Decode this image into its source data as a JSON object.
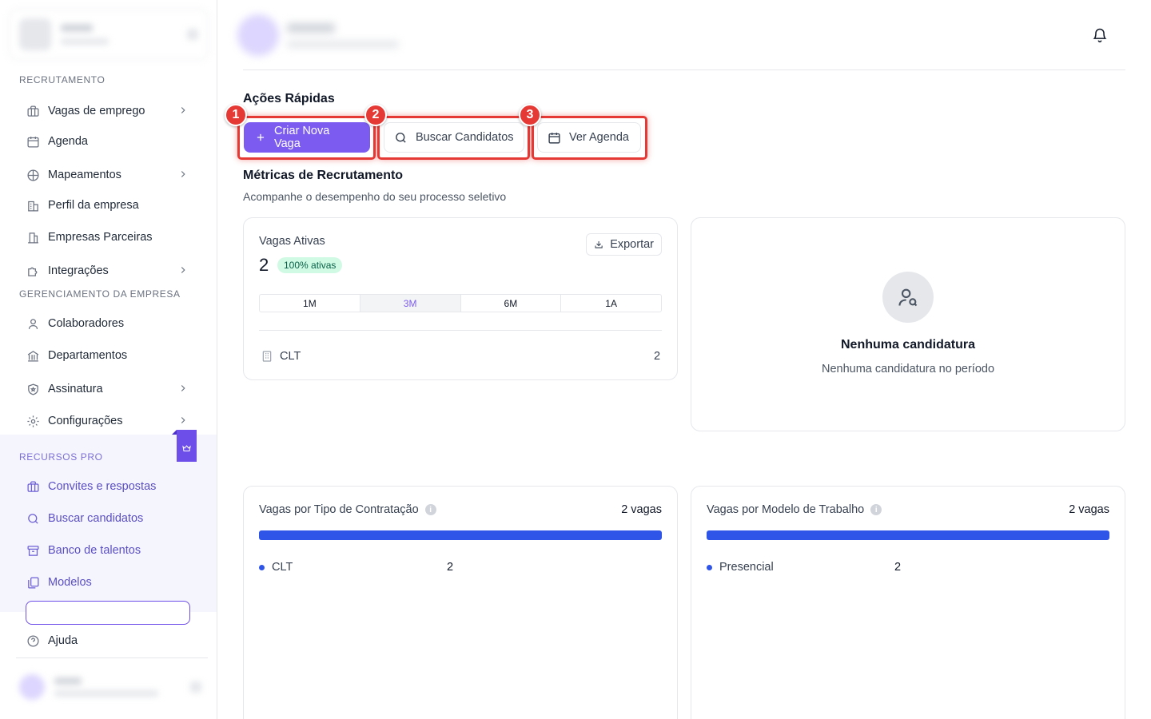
{
  "sidebar": {
    "sections": {
      "recruitment": "RECRUTAMENTO",
      "company": "GERENCIAMENTO DA EMPRESA",
      "pro": "RECURSOS PRO"
    },
    "items": {
      "vagas": "Vagas de emprego",
      "agenda": "Agenda",
      "mapeamentos": "Mapeamentos",
      "perfil": "Perfil da empresa",
      "parceiras": "Empresas Parceiras",
      "integracoes": "Integrações",
      "colaboradores": "Colaboradores",
      "departamentos": "Departamentos",
      "assinatura": "Assinatura",
      "configuracoes": "Configurações",
      "convites": "Convites e respostas",
      "buscar": "Buscar candidatos",
      "banco": "Banco de talentos",
      "modelos": "Modelos",
      "ajuda": "Ajuda"
    }
  },
  "quick_actions": {
    "title": "Ações Rápidas",
    "create_job": "Criar Nova Vaga",
    "search_candidates": "Buscar Candidatos",
    "view_schedule": "Ver Agenda",
    "markers": [
      "1",
      "2",
      "3"
    ]
  },
  "metrics": {
    "title": "Métricas de Recrutamento",
    "subtitle": "Acompanhe o desempenho do seu processo seletivo",
    "active_jobs": {
      "label": "Vagas Ativas",
      "value": "2",
      "pill": "100% ativas",
      "export": "Exportar",
      "periods": [
        "1M",
        "3M",
        "6M",
        "1A"
      ],
      "selected_period": "3M",
      "row_label": "CLT",
      "row_value": "2"
    },
    "empty": {
      "title": "Nenhuma candidatura",
      "subtitle": "Nenhuma candidatura no período"
    },
    "by_contract": {
      "title": "Vagas por Tipo de Contratação",
      "total": "2 vagas",
      "legend_label": "CLT",
      "legend_value": "2",
      "fill_percent": 100
    },
    "by_model": {
      "title": "Vagas por Modelo de Trabalho",
      "total": "2 vagas",
      "legend_label": "Presencial",
      "legend_value": "2",
      "fill_percent": 100
    }
  },
  "colors": {
    "primary": "#7c5cf0",
    "bar": "#2f55e8",
    "highlight": "#e53935"
  }
}
